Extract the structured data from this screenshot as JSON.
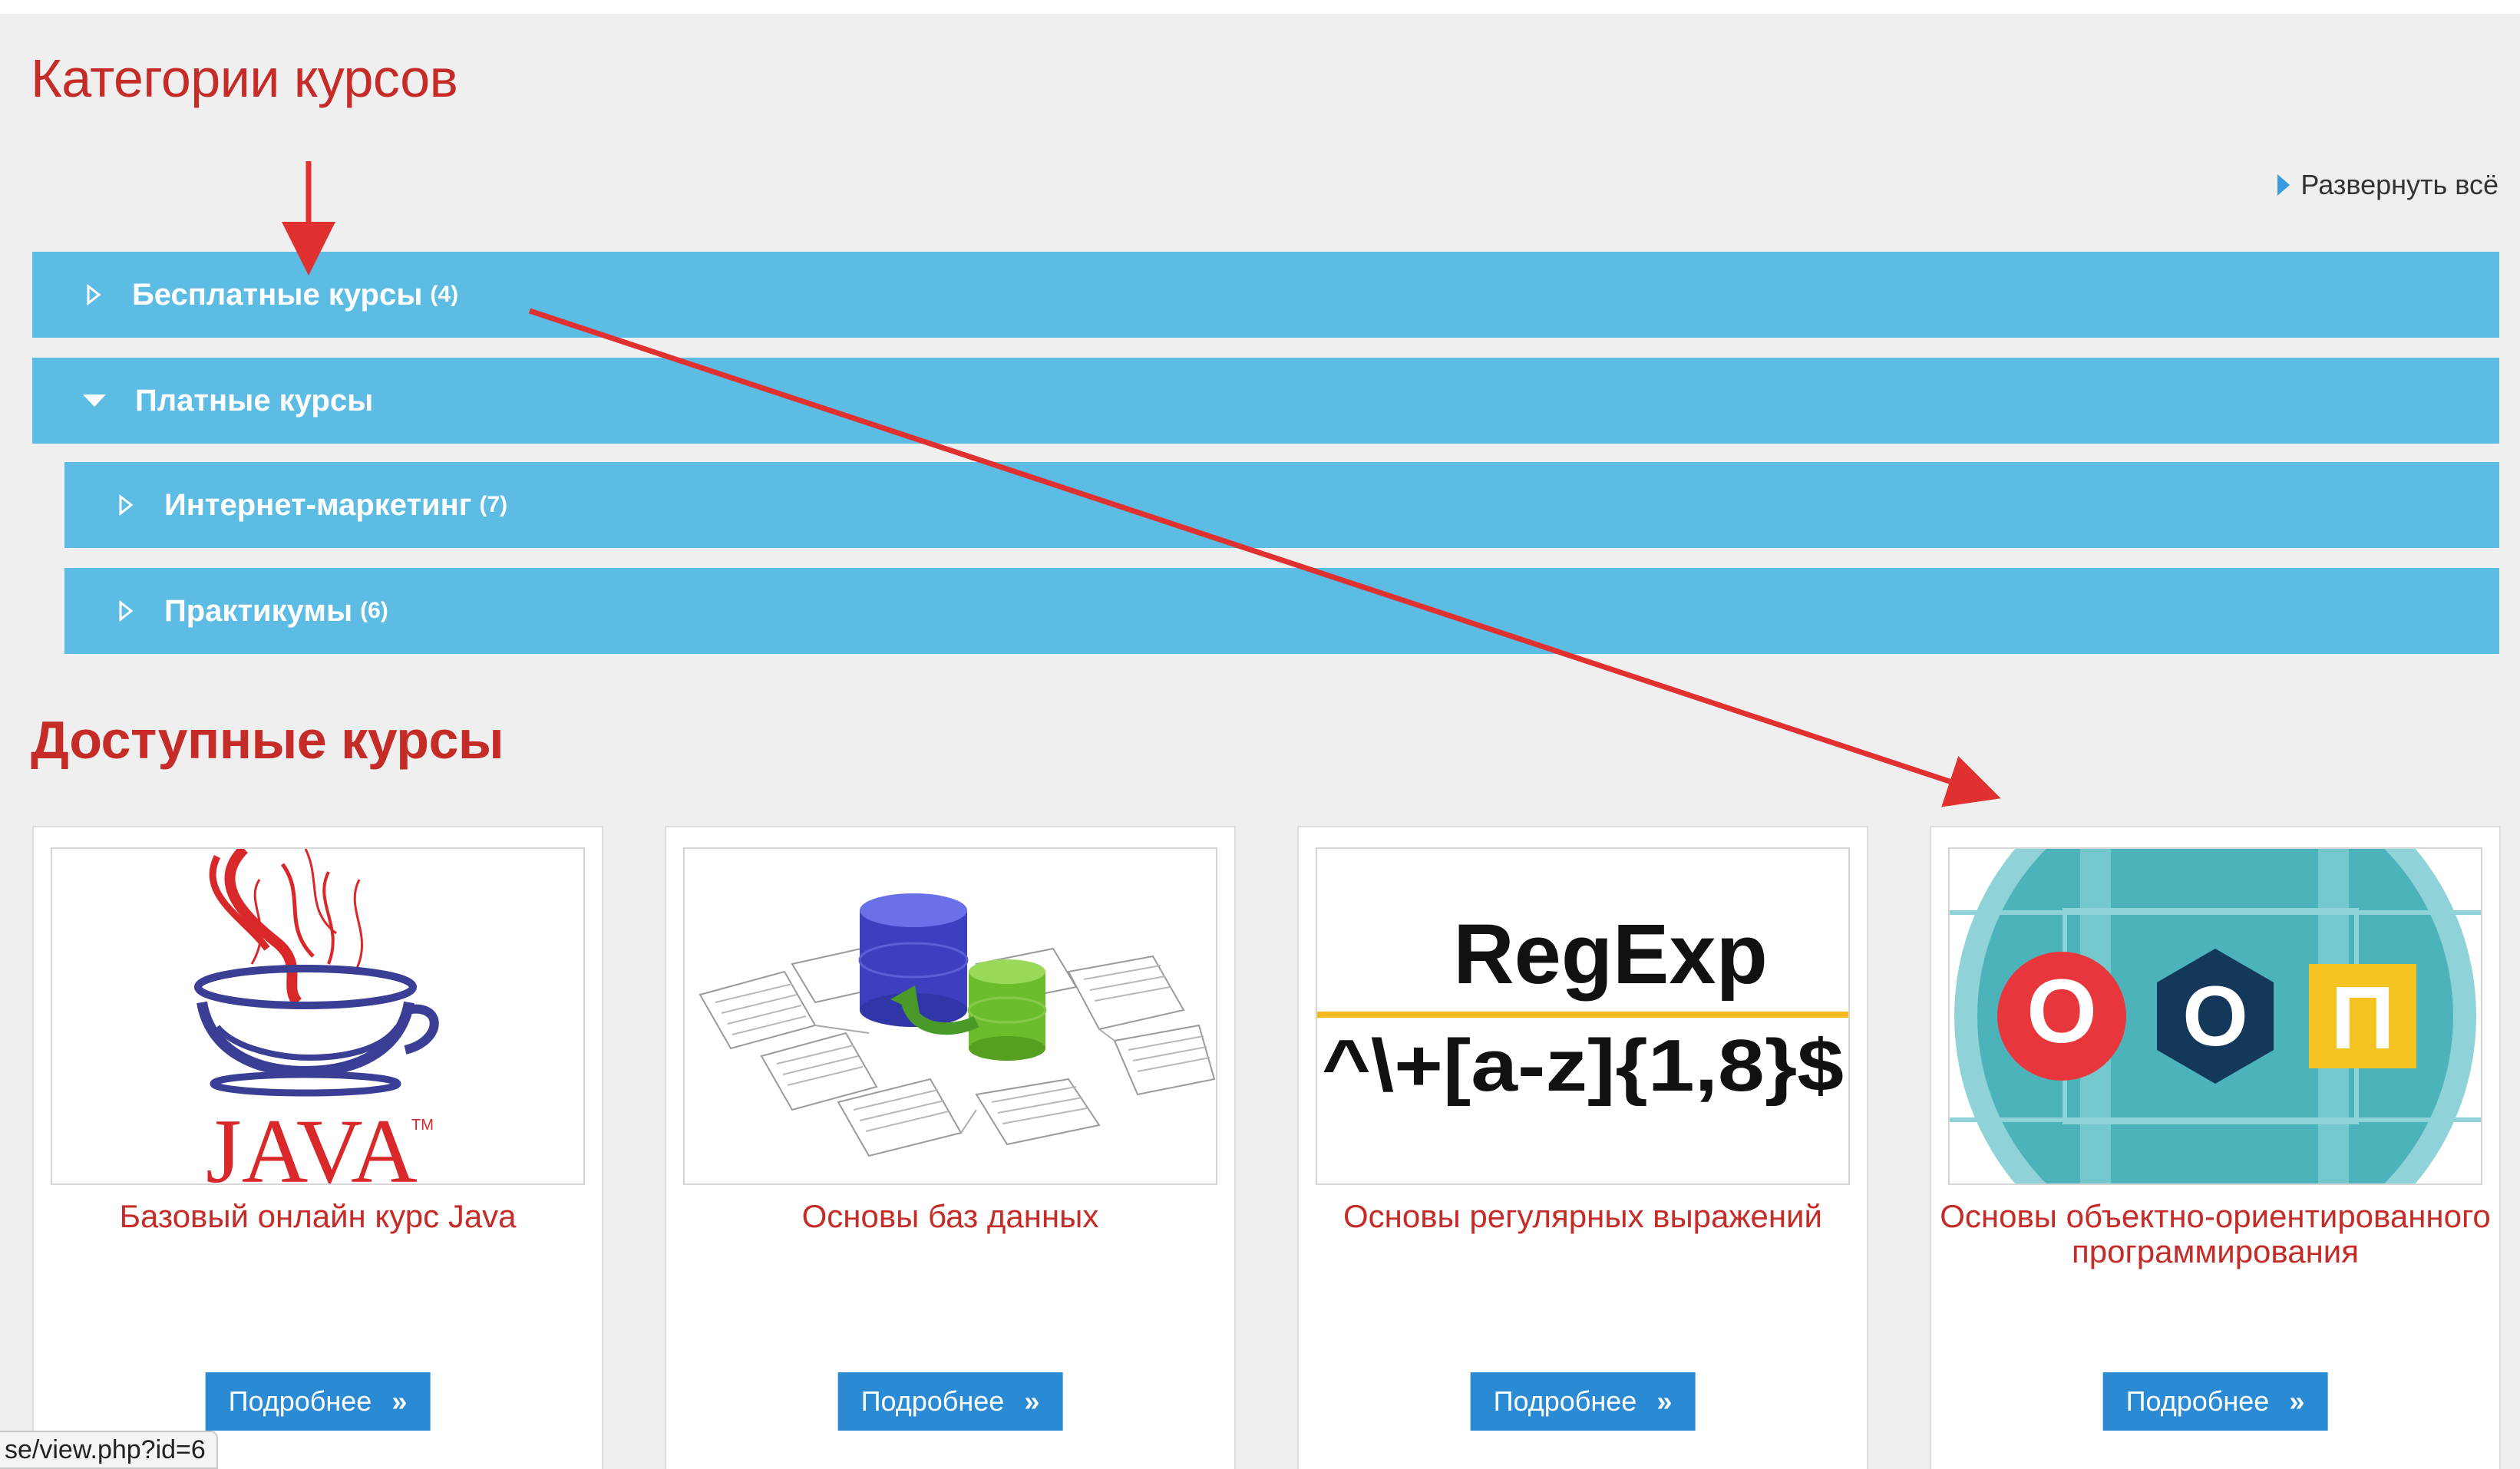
{
  "colors": {
    "accent_red": "#c52c28",
    "category_bar": "#5cbce3",
    "button_blue": "#2a8ad4",
    "background": "#efefef",
    "annotation_arrow": "#e03030"
  },
  "categories_section": {
    "title": "Категории курсов",
    "expand_all_label": "Развернуть всё",
    "expand_all_icon": "triangle-right-icon",
    "items": [
      {
        "label": "Бесплатные курсы",
        "count": "(4)",
        "state": "collapsed",
        "level": 0
      },
      {
        "label": "Платные курсы",
        "count": "",
        "state": "expanded",
        "level": 0
      },
      {
        "label": "Интернет-маркетинг",
        "count": "(7)",
        "state": "collapsed",
        "level": 1
      },
      {
        "label": "Практикумы",
        "count": "(6)",
        "state": "collapsed",
        "level": 1
      }
    ]
  },
  "courses_section": {
    "title": "Доступные курсы",
    "courses": [
      {
        "title": "Базовый онлайн курс Java",
        "button_label": "Подробнее",
        "image": "java-logo",
        "image_text": "JAVA"
      },
      {
        "title": "Основы баз данных",
        "button_label": "Подробнее",
        "image": "database-diagram"
      },
      {
        "title": "Основы регулярных выражений",
        "button_label": "Подробнее",
        "image": "regexp-banner",
        "image_text_top": "RegExp",
        "image_text_bottom": "^\\+[a-z]{1,8}$"
      },
      {
        "title": "Основы объектно-ориентированного программирования",
        "button_label": "Подробнее",
        "image": "oop-badge",
        "image_letters": [
          "О",
          "О",
          "П"
        ]
      }
    ]
  },
  "status_bar": {
    "url": "se/view.php?id=6"
  }
}
